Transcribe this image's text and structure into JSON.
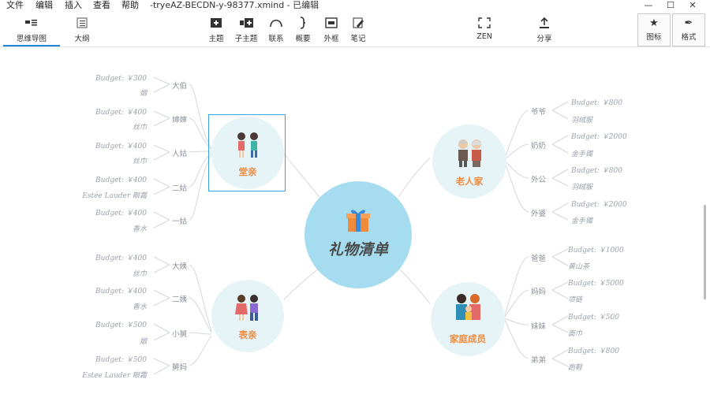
{
  "titlebar": {
    "menus": [
      "文件",
      "编辑",
      "插入",
      "查看",
      "帮助"
    ],
    "doc_title": "-tryeAZ-BECDN-y-98377.xmind - 已编辑",
    "win_min": "—",
    "win_max": "☐",
    "win_close": "✕"
  },
  "toolbar": {
    "mode_mindmap": "思维导图",
    "mode_outline": "大纲",
    "topic": "主题",
    "subtopic": "子主题",
    "relationship": "联系",
    "summary": "概要",
    "boundary": "外框",
    "note": "笔记",
    "zen": "ZEN",
    "share": "分享",
    "icon_panel": "图标",
    "format_panel": "格式"
  },
  "map": {
    "central": "礼物清单",
    "branches": {
      "relatives": "堂亲",
      "elders": "老人家",
      "cousins": "表亲",
      "family": "家庭成员"
    },
    "left_top": [
      {
        "cat": "大伯",
        "items": [
          "Budget: ￥300",
          "烟"
        ]
      },
      {
        "cat": "婶婶",
        "items": [
          "Budget: ￥400",
          "丝巾"
        ]
      },
      {
        "cat": "人姑",
        "items": [
          "Budget: ￥400",
          "丝巾"
        ]
      },
      {
        "cat": "二姑",
        "items": [
          "Budget: ￥400",
          "Estée Lauder 眼霜"
        ]
      },
      {
        "cat": "一姑",
        "items": [
          "Budget: ￥400",
          "香水"
        ]
      }
    ],
    "left_bottom": [
      {
        "cat": "大姨",
        "items": [
          "Budget: ￥400",
          "丝巾"
        ]
      },
      {
        "cat": "二姨",
        "items": [
          "Budget: ￥400",
          "香水"
        ]
      },
      {
        "cat": "小舅",
        "items": [
          "Budget: ￥500",
          "烟"
        ]
      },
      {
        "cat": "舅妈",
        "items": [
          "Budget: ￥500",
          "Estee Lauder 眼霜"
        ]
      }
    ],
    "right_top": [
      {
        "cat": "爷爷",
        "items": [
          "Budget: ￥800",
          "羽绒服"
        ]
      },
      {
        "cat": "奶奶",
        "items": [
          "Budget: ￥2000",
          "金手镯"
        ]
      },
      {
        "cat": "外公",
        "items": [
          "Budget: ￥800",
          "羽绒服"
        ]
      },
      {
        "cat": "外婆",
        "items": [
          "Budget: ￥2000",
          "金手镯"
        ]
      }
    ],
    "right_bottom": [
      {
        "cat": "爸爸",
        "items": [
          "Budget: ￥1000",
          "黄山茶"
        ]
      },
      {
        "cat": "妈妈",
        "items": [
          "Budget: ￥5000",
          "项链"
        ]
      },
      {
        "cat": "妹妹",
        "items": [
          "Budget: ￥500",
          "面巾"
        ]
      },
      {
        "cat": "弟弟",
        "items": [
          "Budget: ￥800",
          "跑鞋"
        ]
      }
    ]
  },
  "colors": {
    "accent": "#1a86d9",
    "central_fill": "#a6dcef",
    "branch_fill": "#e6f4f8",
    "branch_text": "#f08a3c",
    "line": "#cfd5da"
  }
}
